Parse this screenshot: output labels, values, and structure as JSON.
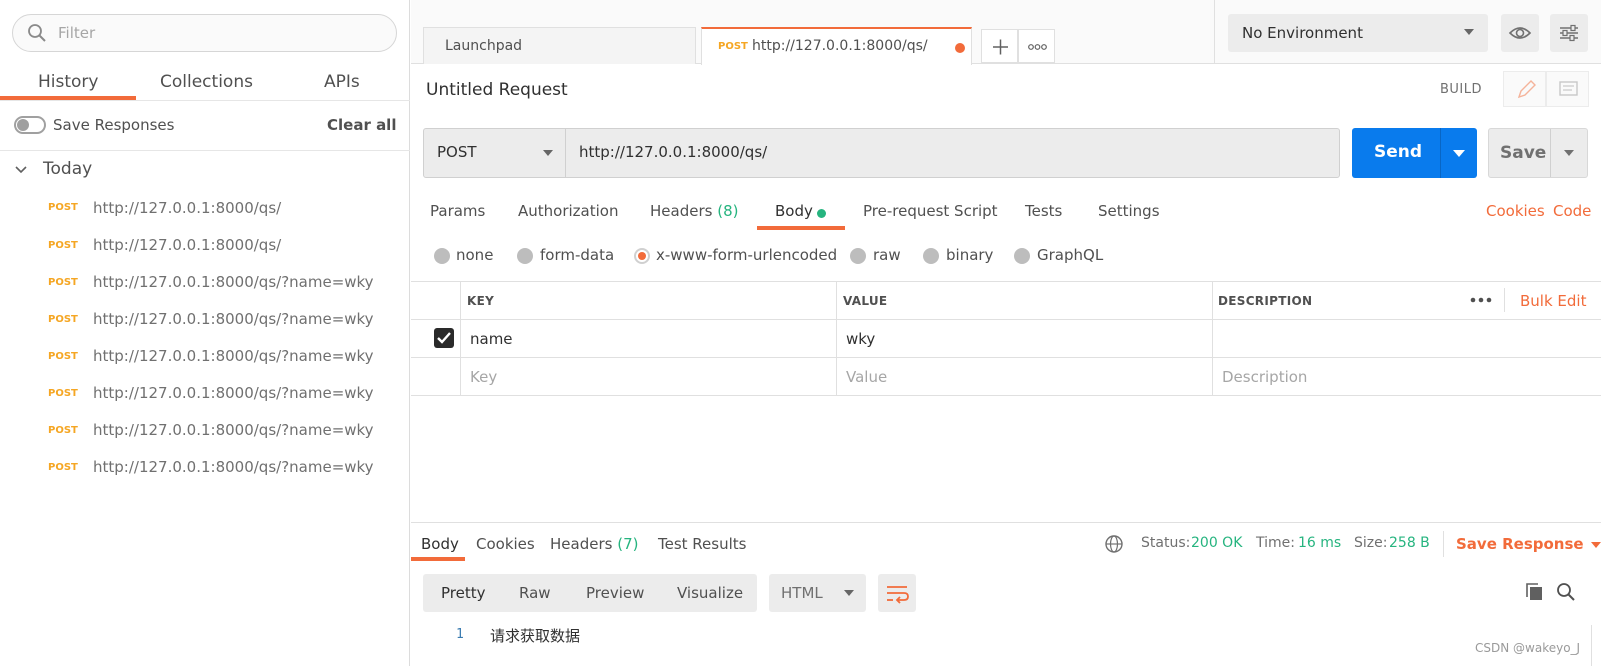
{
  "sidebar": {
    "filter_placeholder": "Filter",
    "tabs": [
      "History",
      "Collections",
      "APIs"
    ],
    "save_responses": "Save Responses",
    "clear_all": "Clear all",
    "group": "Today",
    "history": [
      {
        "method": "POST",
        "url": "http://127.0.0.1:8000/qs/"
      },
      {
        "method": "POST",
        "url": "http://127.0.0.1:8000/qs/"
      },
      {
        "method": "POST",
        "url": "http://127.0.0.1:8000/qs/?name=wky"
      },
      {
        "method": "POST",
        "url": "http://127.0.0.1:8000/qs/?name=wky"
      },
      {
        "method": "POST",
        "url": "http://127.0.0.1:8000/qs/?name=wky"
      },
      {
        "method": "POST",
        "url": "http://127.0.0.1:8000/qs/?name=wky"
      },
      {
        "method": "POST",
        "url": "http://127.0.0.1:8000/qs/?name=wky"
      },
      {
        "method": "POST",
        "url": "http://127.0.0.1:8000/qs/?name=wky"
      }
    ]
  },
  "tabs": {
    "launchpad": "Launchpad",
    "active_method": "POST",
    "active_url": "http://127.0.0.1:8000/qs/"
  },
  "environment": {
    "selected": "No Environment"
  },
  "request": {
    "title": "Untitled Request",
    "build": "BUILD",
    "method": "POST",
    "url": "http://127.0.0.1:8000/qs/",
    "send": "Send",
    "save": "Save",
    "tabs": {
      "params": "Params",
      "authorization": "Authorization",
      "headers": "Headers",
      "headers_count": "(8)",
      "body": "Body",
      "prerequest": "Pre-request Script",
      "tests": "Tests",
      "settings": "Settings"
    },
    "cookies": "Cookies",
    "code": "Code",
    "body_types": [
      "none",
      "form-data",
      "x-www-form-urlencoded",
      "raw",
      "binary",
      "GraphQL"
    ],
    "body_type_selected": "x-www-form-urlencoded",
    "table": {
      "headers": [
        "KEY",
        "VALUE",
        "DESCRIPTION"
      ],
      "bulk_edit": "Bulk Edit",
      "rows": [
        {
          "key": "name",
          "value": "wky",
          "description": ""
        }
      ],
      "placeholders": {
        "key": "Key",
        "value": "Value",
        "description": "Description"
      }
    }
  },
  "response": {
    "tabs": {
      "body": "Body",
      "cookies": "Cookies",
      "headers": "Headers",
      "headers_count": "(7)",
      "tests": "Test Results"
    },
    "status_label": "Status:",
    "status": "200 OK",
    "time_label": "Time:",
    "time": "16 ms",
    "size_label": "Size:",
    "size": "258 B",
    "save_response": "Save Response",
    "formats": [
      "Pretty",
      "Raw",
      "Preview",
      "Visualize"
    ],
    "language": "HTML",
    "line_number": "1",
    "content": "请求获取数据"
  },
  "watermark": "CSDN @wakeyo_J",
  "colors": {
    "accent": "#f26b3a",
    "send": "#097bed",
    "method": "#f5a623",
    "success": "#26b47f"
  }
}
